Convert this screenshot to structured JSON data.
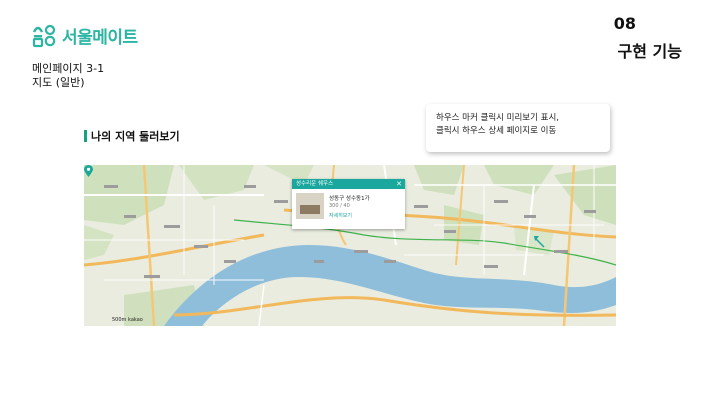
{
  "brand": {
    "name": "서울메이트",
    "color": "#2bb5a3"
  },
  "slide": {
    "number": "08",
    "section_title": "구현 기능",
    "highlight_color": "#f7e600"
  },
  "page_label": {
    "line1": "메인페이지 3-1",
    "line2": "지도 (일반)"
  },
  "callout": {
    "line1": "하우스 마커 클릭시 미리보기 표시,",
    "line2": "클릭시 하우스 상세 페이지로 이동"
  },
  "map_section": {
    "heading": "나의 지역 둘러보기",
    "accent_color": "#16a084"
  },
  "map": {
    "popup": {
      "title": "성수리운 쉐우스",
      "close_icon": "close-icon",
      "address": "성동구 성수동1가",
      "price": "300 / 40",
      "link": "자세히보기"
    },
    "marker_icon": "map-pin-icon",
    "scale_label": "500m",
    "provider": "kakao"
  }
}
